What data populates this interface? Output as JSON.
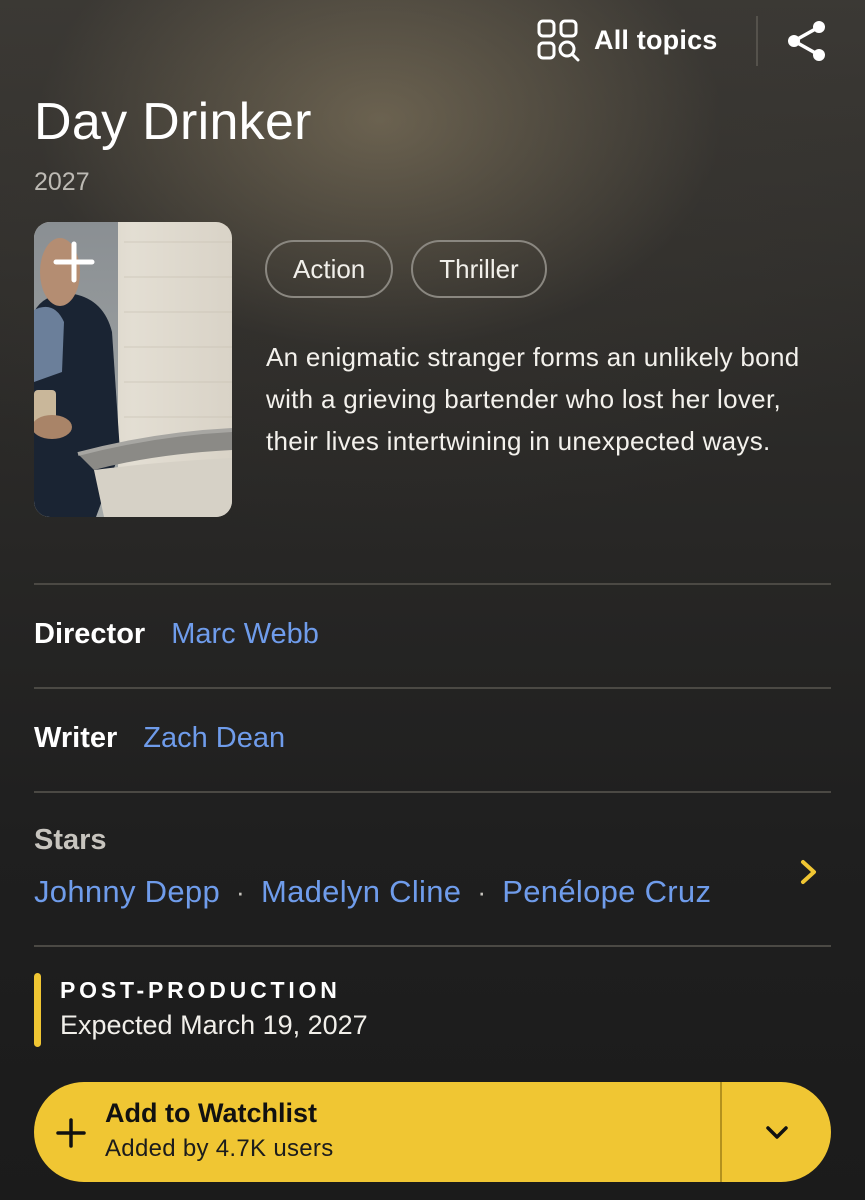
{
  "header": {
    "topics_label": "All topics",
    "topics_icon": "grid-search-icon",
    "share_icon": "share-icon"
  },
  "title": {
    "name": "Day Drinker",
    "year": "2027"
  },
  "poster": {
    "add_icon": "plus-icon"
  },
  "genres": [
    "Action",
    "Thriller"
  ],
  "plot": "An enigmatic stranger forms an unlikely bond with a grieving bartender who lost her lover, their lives intertwining in unexpected ways.",
  "credits": {
    "director_label": "Director",
    "director": "Marc Webb",
    "writer_label": "Writer",
    "writer": "Zach Dean",
    "stars_label": "Stars",
    "stars": [
      "Johnny Depp",
      "Madelyn Cline",
      "Penélope Cruz"
    ],
    "separator": "·"
  },
  "status": {
    "label": "POST-PRODUCTION",
    "date": "Expected March 19, 2027"
  },
  "watchlist": {
    "title": "Add to Watchlist",
    "subtitle": "Added by 4.7K users",
    "dropdown_icon": "chevron-down-icon"
  },
  "colors": {
    "accent_yellow": "#f0c633",
    "link_blue": "#6f9ceb",
    "background": "#2b2a28"
  }
}
